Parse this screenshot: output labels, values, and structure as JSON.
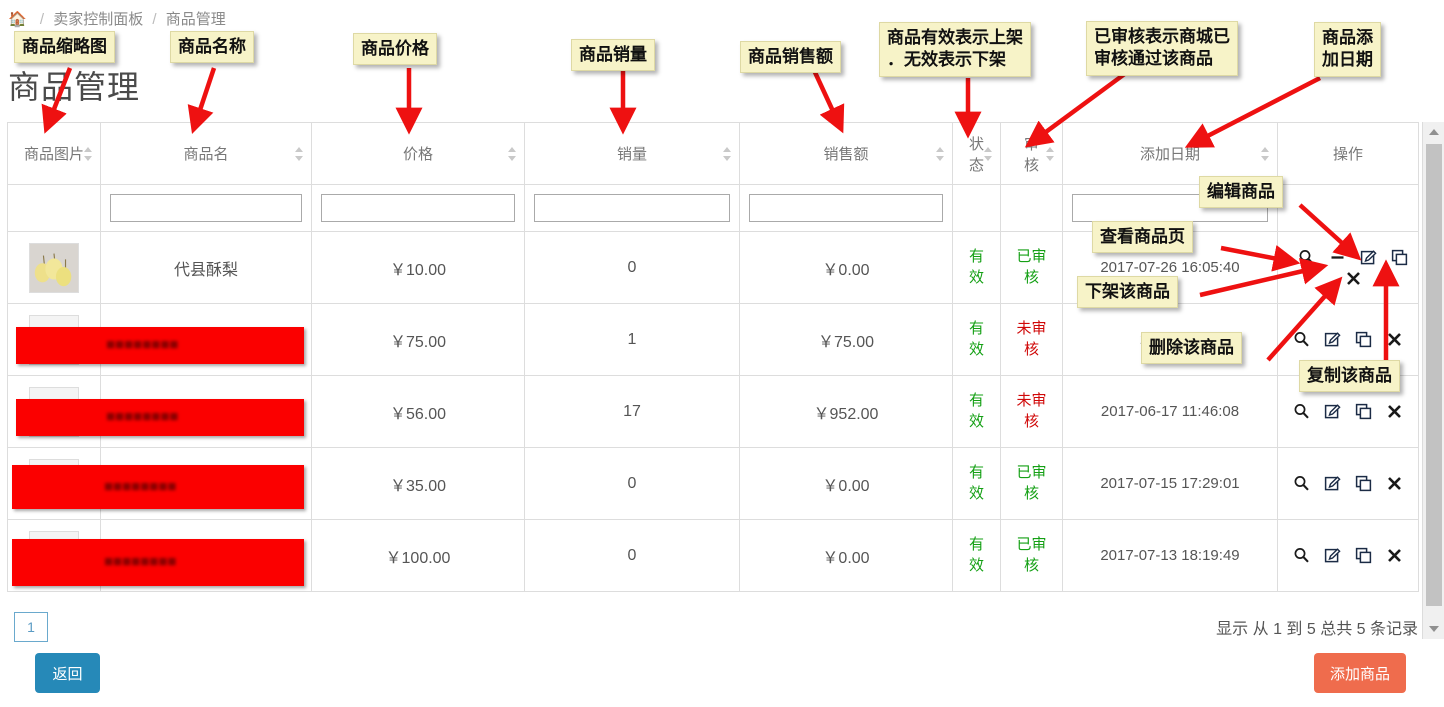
{
  "breadcrumb": {
    "home_icon": "home-icon",
    "items": [
      "卖家控制面板",
      "商品管理"
    ],
    "sep": "/"
  },
  "page": {
    "title": "商品管理"
  },
  "table": {
    "columns": [
      {
        "key": "image",
        "label": "商品图片",
        "sortable": true
      },
      {
        "key": "name",
        "label": "商品名",
        "sortable": true
      },
      {
        "key": "price",
        "label": "价格",
        "sortable": true
      },
      {
        "key": "sales",
        "label": "销量",
        "sortable": true
      },
      {
        "key": "amount",
        "label": "销售额",
        "sortable": true
      },
      {
        "key": "status",
        "label": "状态",
        "sortable": true
      },
      {
        "key": "audit",
        "label": "审核",
        "sortable": true
      },
      {
        "key": "date",
        "label": "添加日期",
        "sortable": true
      },
      {
        "key": "ops",
        "label": "操作",
        "sortable": false
      }
    ],
    "filters": [
      {
        "key": "image",
        "has_input": false,
        "value": "",
        "placeholder": ""
      },
      {
        "key": "name",
        "has_input": true,
        "value": "",
        "placeholder": ""
      },
      {
        "key": "price",
        "has_input": true,
        "value": "",
        "placeholder": ""
      },
      {
        "key": "sales",
        "has_input": true,
        "value": "",
        "placeholder": ""
      },
      {
        "key": "amount",
        "has_input": true,
        "value": "",
        "placeholder": ""
      },
      {
        "key": "status",
        "has_input": false,
        "value": "",
        "placeholder": ""
      },
      {
        "key": "audit",
        "has_input": false,
        "value": "",
        "placeholder": ""
      },
      {
        "key": "date",
        "has_input": true,
        "value": "",
        "placeholder": ""
      },
      {
        "key": "ops",
        "has_input": false,
        "value": "",
        "placeholder": ""
      }
    ],
    "rows": [
      {
        "image": "pear-thumbnail",
        "redacted": false,
        "name": "代县酥梨",
        "price": "￥10.00",
        "sales": "0",
        "amount": "￥0.00",
        "status": "有效",
        "status_state": "ok",
        "audit": "已审核",
        "audit_state": "approved",
        "date": "2017-07-26 16:05:40",
        "ops": [
          "search-icon",
          "minus-icon",
          "edit-icon",
          "copy-icon",
          "close-icon"
        ]
      },
      {
        "image": "redacted-thumbnail",
        "redacted": true,
        "name": "",
        "price": "￥75.00",
        "sales": "1",
        "amount": "￥75.00",
        "status": "有效",
        "status_state": "ok",
        "audit": "未审核",
        "audit_state": "pending",
        "date": "2017-06-",
        "ops": [
          "search-icon",
          "edit-icon",
          "copy-icon",
          "close-icon"
        ]
      },
      {
        "image": "redacted-thumbnail",
        "redacted": true,
        "name": "",
        "price": "￥56.00",
        "sales": "17",
        "amount": "￥952.00",
        "status": "有效",
        "status_state": "ok",
        "audit": "未审核",
        "audit_state": "pending",
        "date": "2017-06-17 11:46:08",
        "ops": [
          "search-icon",
          "edit-icon",
          "copy-icon",
          "close-icon"
        ]
      },
      {
        "image": "redacted-thumbnail",
        "redacted": true,
        "name": "",
        "price": "￥35.00",
        "sales": "0",
        "amount": "￥0.00",
        "status": "有效",
        "status_state": "ok",
        "audit": "已审核",
        "audit_state": "approved",
        "date": "2017-07-15 17:29:01",
        "ops": [
          "search-icon",
          "edit-icon",
          "copy-icon",
          "close-icon"
        ]
      },
      {
        "image": "redacted-thumbnail",
        "redacted": true,
        "name": "",
        "price": "￥100.00",
        "sales": "0",
        "amount": "￥0.00",
        "status": "有效",
        "status_state": "ok",
        "audit": "已审核",
        "audit_state": "approved",
        "date": "2017-07-13 18:19:49",
        "ops": [
          "search-icon",
          "edit-icon",
          "copy-icon",
          "close-icon"
        ]
      }
    ]
  },
  "footer": {
    "page_number": "1",
    "info": "显示 从 1 到 5 总共 5 条记录",
    "back_label": "返回",
    "add_label": "添加商品"
  },
  "annotations": [
    {
      "id": "thumb",
      "text": "商品缩略图"
    },
    {
      "id": "name",
      "text": "商品名称"
    },
    {
      "id": "price",
      "text": "商品价格"
    },
    {
      "id": "sales",
      "text": "商品销量"
    },
    {
      "id": "amount",
      "text": "商品销售额"
    },
    {
      "id": "status",
      "text": "商品有效表示上架\n．无效表示下架"
    },
    {
      "id": "audit",
      "text": "已审核表示商城已\n审核通过该商品"
    },
    {
      "id": "date",
      "text": "商品添\n加日期"
    },
    {
      "id": "edit",
      "text": "编辑商品"
    },
    {
      "id": "view",
      "text": "查看商品页"
    },
    {
      "id": "offline",
      "text": "下架该商品"
    },
    {
      "id": "delete",
      "text": "删除该商品"
    },
    {
      "id": "copy",
      "text": "复制该商品"
    }
  ],
  "colors": {
    "annotation_bg": "#f7f3c8",
    "arrow": "#ee1111",
    "status_ok": "#15a015",
    "audit_pending": "#d00808",
    "back_button": "#2689b8",
    "add_button": "#ef6c4d",
    "redaction": "#fb0000"
  }
}
